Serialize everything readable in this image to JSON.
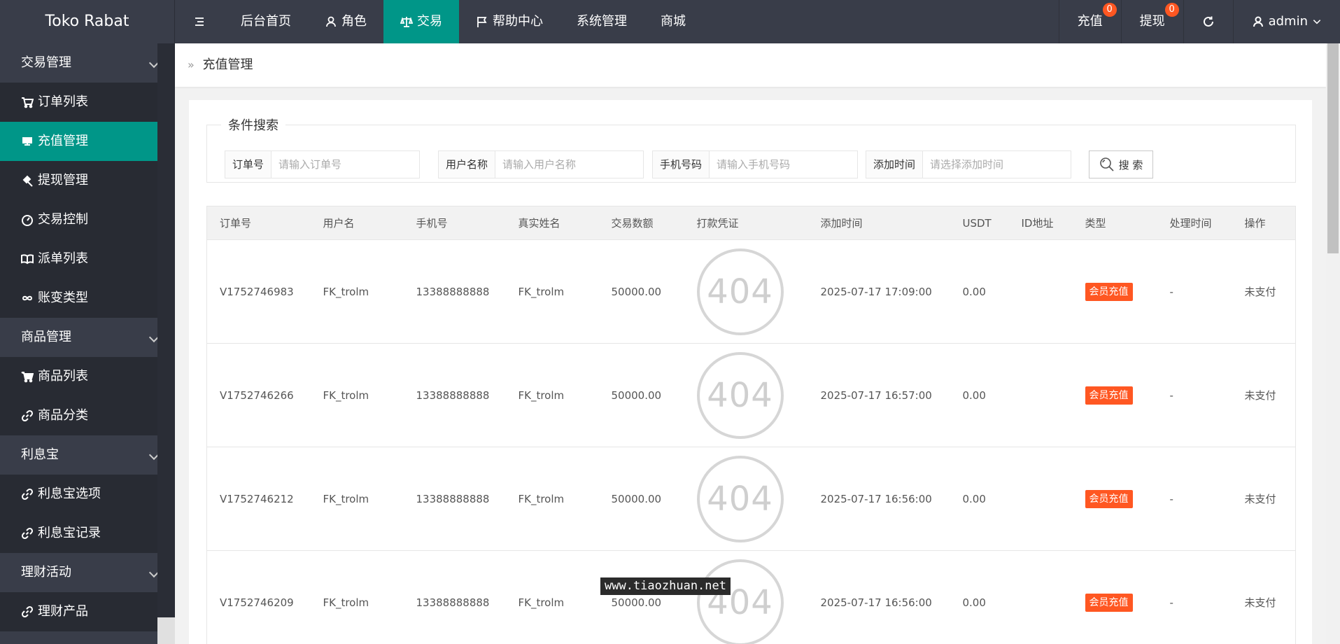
{
  "app": {
    "title": "Toko Rabat"
  },
  "topnav": {
    "items": [
      {
        "label": "后台首页"
      },
      {
        "label": "角色"
      },
      {
        "label": "交易"
      },
      {
        "label": "帮助中心"
      },
      {
        "label": "系统管理"
      },
      {
        "label": "商城"
      }
    ],
    "recharge_label": "充值",
    "recharge_badge": "0",
    "withdraw_label": "提现",
    "withdraw_badge": "0",
    "user_label": "admin"
  },
  "sidebar": {
    "groups": [
      {
        "label": "交易管理",
        "items": [
          "订单列表",
          "充值管理",
          "提现管理",
          "交易控制",
          "派单列表",
          "账变类型"
        ]
      },
      {
        "label": "商品管理",
        "items": [
          "商品列表",
          "商品分类"
        ]
      },
      {
        "label": "利息宝",
        "items": [
          "利息宝选项",
          "利息宝记录"
        ]
      },
      {
        "label": "理财活动",
        "items": [
          "理财产品"
        ]
      }
    ]
  },
  "breadcrumb": {
    "current": "充值管理"
  },
  "search": {
    "legend": "条件搜索",
    "fields": [
      {
        "label": "订单号",
        "placeholder": "请输入订单号",
        "value": ""
      },
      {
        "label": "用户名称",
        "placeholder": "请输入用户名称",
        "value": ""
      },
      {
        "label": "手机号码",
        "placeholder": "请输入手机号码",
        "value": ""
      },
      {
        "label": "添加时间",
        "placeholder": "请选择添加时间",
        "value": ""
      }
    ],
    "button_label": "搜 索"
  },
  "table": {
    "columns": [
      "订单号",
      "用户名",
      "手机号",
      "真实姓名",
      "交易数额",
      "打款凭证",
      "添加时间",
      "USDT",
      "ID地址",
      "类型",
      "处理时间",
      "操作"
    ],
    "rows": [
      {
        "order": "V1752746983",
        "user": "FK_trolm",
        "phone": "13388888888",
        "realname": "FK_trolm",
        "amount": "50000.00",
        "voucher": "404",
        "time": "2025-07-17 17:09:00",
        "usdt": "0.00",
        "addr": "",
        "type": "会员充值",
        "handled": "-",
        "status": "未支付"
      },
      {
        "order": "V1752746266",
        "user": "FK_trolm",
        "phone": "13388888888",
        "realname": "FK_trolm",
        "amount": "50000.00",
        "voucher": "404",
        "time": "2025-07-17 16:57:00",
        "usdt": "0.00",
        "addr": "",
        "type": "会员充值",
        "handled": "-",
        "status": "未支付"
      },
      {
        "order": "V1752746212",
        "user": "FK_trolm",
        "phone": "13388888888",
        "realname": "FK_trolm",
        "amount": "50000.00",
        "voucher": "404",
        "time": "2025-07-17 16:56:00",
        "usdt": "0.00",
        "addr": "",
        "type": "会员充值",
        "handled": "-",
        "status": "未支付"
      },
      {
        "order": "V1752746209",
        "user": "FK_trolm",
        "phone": "13388888888",
        "realname": "FK_trolm",
        "amount": "50000.00",
        "voucher": "404",
        "time": "2025-07-17 16:56:00",
        "usdt": "0.00",
        "addr": "",
        "type": "会员充值",
        "handled": "-",
        "status": "未支付"
      }
    ]
  },
  "watermark": "www.tiaozhuan.net",
  "colors": {
    "header": "#393d49",
    "accent": "#009688",
    "badge": "#ff5722",
    "sidebar_sub": "#282b33"
  }
}
